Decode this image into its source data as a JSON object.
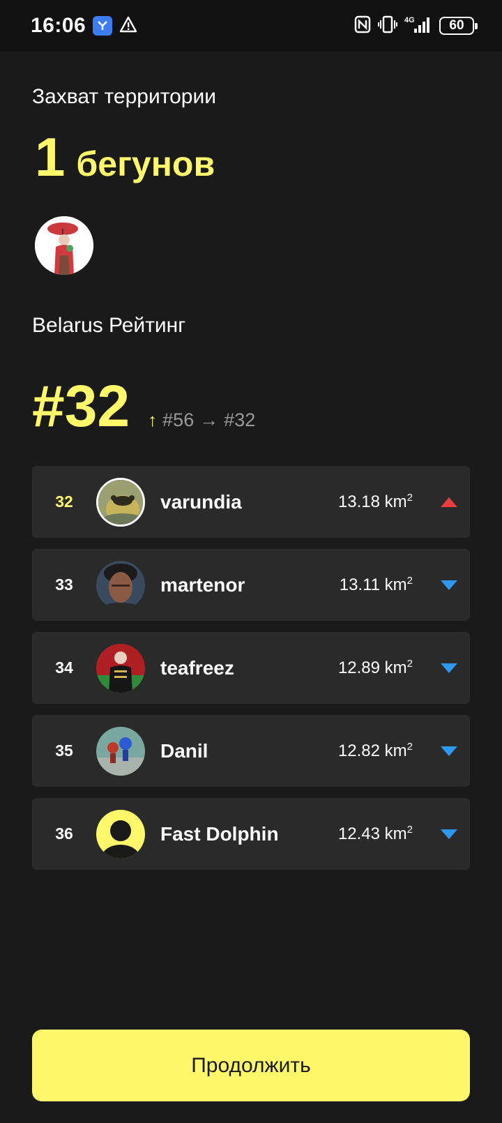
{
  "status_bar": {
    "time": "16:06",
    "battery": "60",
    "network": "4G",
    "icons": [
      "app-notification-icon",
      "warning-icon",
      "nfc-icon",
      "vibrate-icon",
      "signal-icon",
      "battery-icon"
    ]
  },
  "territory": {
    "title": "Захват территории",
    "count": "1",
    "count_label": "бегунов"
  },
  "rating": {
    "title": "Belarus Рейтинг",
    "rank": "#32",
    "change_from": "#56",
    "arrow": "→",
    "change_to": "#32"
  },
  "leaderboard": [
    {
      "rank": "32",
      "name": "varundia",
      "area": "13.18 km",
      "trend": "up",
      "is_me": true
    },
    {
      "rank": "33",
      "name": "martenor",
      "area": "13.11 km",
      "trend": "down",
      "is_me": false
    },
    {
      "rank": "34",
      "name": "teafreez",
      "area": "12.89 km",
      "trend": "down",
      "is_me": false
    },
    {
      "rank": "35",
      "name": "Danil",
      "area": "12.82 km",
      "trend": "down",
      "is_me": false
    },
    {
      "rank": "36",
      "name": "Fast Dolphin",
      "area": "12.43 km",
      "trend": "down",
      "is_me": false
    }
  ],
  "area_unit_sup": "2",
  "continue_label": "Продолжить",
  "colors": {
    "background": "#1a1a1a",
    "accent": "#fff86b",
    "row_bg": "#2a2a2a",
    "trend_up": "#ea3e3e",
    "trend_down": "#2e98f0"
  }
}
